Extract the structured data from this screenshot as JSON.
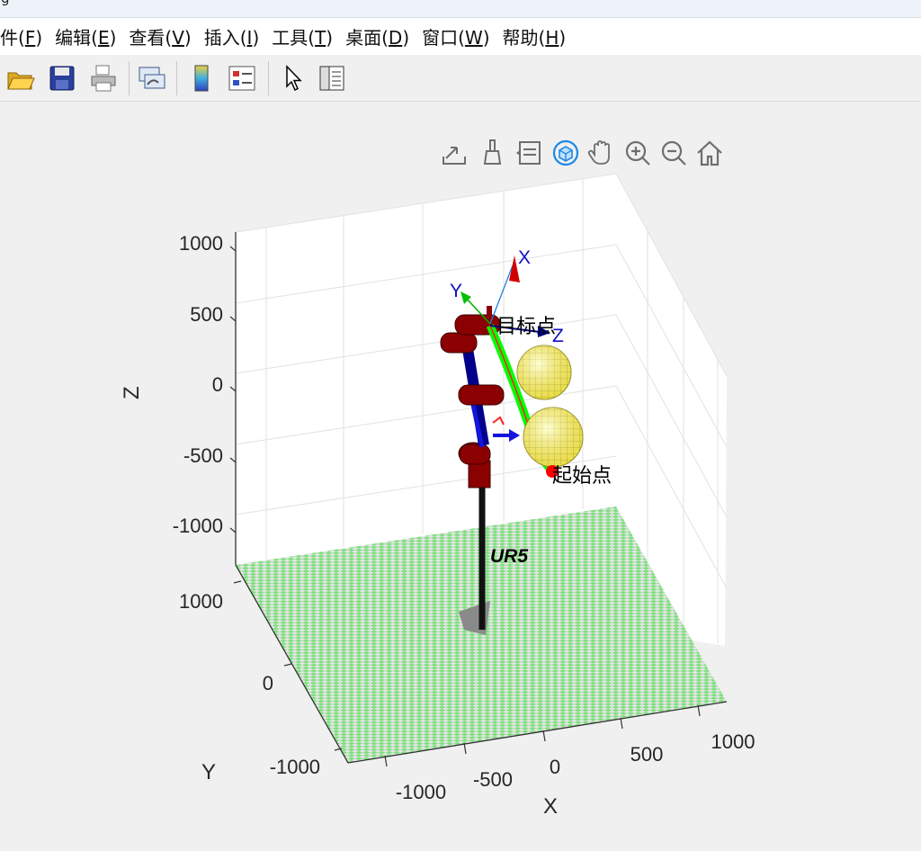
{
  "window": {
    "title_fragment": "g"
  },
  "menu": [
    {
      "label": "件",
      "key": "F"
    },
    {
      "label": "编辑",
      "key": "E"
    },
    {
      "label": "查看",
      "key": "V"
    },
    {
      "label": "插入",
      "key": "I"
    },
    {
      "label": "工具",
      "key": "T"
    },
    {
      "label": "桌面",
      "key": "D"
    },
    {
      "label": "窗口",
      "key": "W"
    },
    {
      "label": "帮助",
      "key": "H"
    }
  ],
  "toolbar": {
    "icons": [
      "open-file-icon",
      "save-icon",
      "print-icon",
      "link-plot-icon",
      "colorbar-icon",
      "legend-icon",
      "pointer-icon",
      "property-inspector-icon"
    ]
  },
  "axes_toolbar": {
    "icons": [
      "export-icon",
      "brush-icon",
      "data-tips-icon",
      "rotate-3d-icon",
      "pan-icon",
      "zoom-in-icon",
      "zoom-out-icon",
      "home-icon"
    ],
    "active": "rotate-3d-icon"
  },
  "plot": {
    "z_label": "Z",
    "y_label": "Y",
    "x_label": "X",
    "z_ticks": [
      "1000",
      "500",
      "0",
      "-500",
      "-1000"
    ],
    "y_ticks": [
      "1000",
      "0",
      "-1000"
    ],
    "x_ticks": [
      "-1000",
      "-500",
      "0",
      "500",
      "1000"
    ],
    "robot_name": "UR5",
    "target_label": "目标点",
    "start_label": "起始点",
    "frame_labels": {
      "x": "X",
      "y": "Y",
      "z": "Z"
    },
    "colors": {
      "floor_checker_a": "#7ee07e",
      "floor_checker_b": "#e4e4e4",
      "links": "#8b0000",
      "arm": "#00008b",
      "trajectory": "#00ff00",
      "obstacle": "#ffff66",
      "start_point": "#ff0000",
      "frame_x": "#d00000",
      "frame_y": "#00b000",
      "frame_z": "#000080"
    }
  }
}
